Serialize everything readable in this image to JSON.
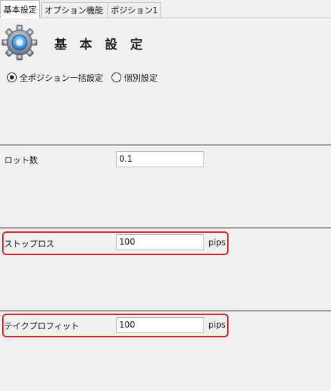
{
  "tabs": [
    {
      "label": "基本設定",
      "active": true
    },
    {
      "label": "オプション機能",
      "active": false
    },
    {
      "label": "ポジション1",
      "active": false
    }
  ],
  "header": {
    "title": "基 本 設 定",
    "icon": "gear-icon"
  },
  "mode": {
    "options": [
      {
        "label": "全ポジション一括設定",
        "selected": true
      },
      {
        "label": "個別設定",
        "selected": false
      }
    ]
  },
  "fields": {
    "lot": {
      "label": "ロット数",
      "value": "0.1",
      "unit": ""
    },
    "stop_loss": {
      "label": "ストップロス",
      "value": "100",
      "unit": "pips"
    },
    "take_profit": {
      "label": "テイクプロフィット",
      "value": "100",
      "unit": "pips"
    }
  },
  "colors": {
    "background": "#f0f0f0",
    "highlight": "#e02020",
    "divider": "#9a9a9a"
  }
}
